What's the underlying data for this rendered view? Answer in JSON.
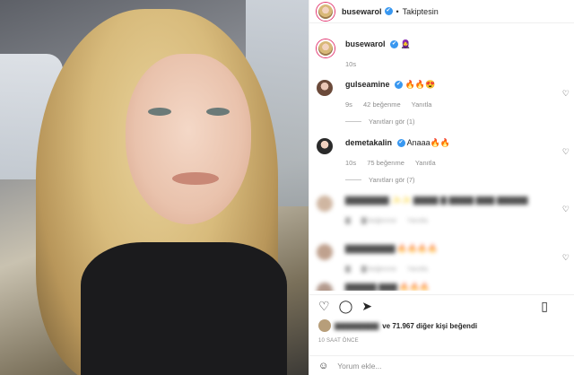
{
  "post": {
    "username": "busewarol",
    "follow_status": "Takiptesin",
    "caption_emoji": "🧕",
    "caption_time": "10s"
  },
  "comments": [
    {
      "username": "gulseamine",
      "text": "🔥🔥😍",
      "time": "9s",
      "likes": "42 beğenme",
      "reply": "Yanıtla",
      "view_replies": "Yanıtları gör (1)"
    },
    {
      "username": "demetakalin",
      "text": "Anaaa🔥🔥",
      "time": "10s",
      "likes": "75 beğenme",
      "reply": "Yanıtla",
      "view_replies": "Yanıtları gör (7)"
    },
    {
      "username": "▇▇▇▇▇▇▇",
      "text": "✨✨ ▇▇▇▇ ▇ ▇▇▇▇ ▇▇▇ ▇▇▇▇▇",
      "time": "▇",
      "likes": "▇ beğenme",
      "reply": "Yanıtla"
    },
    {
      "username": "▇▇▇▇▇▇▇▇",
      "text": "🔥🔥🔥🔥",
      "time": "▇",
      "likes": "▇ beğenme",
      "reply": "Yanıtla"
    },
    {
      "username": "▇▇▇▇▇",
      "text": "▇▇▇ 🔥🔥🔥",
      "time": "",
      "likes": "",
      "reply": ""
    }
  ],
  "likes": {
    "blurred_name": "▇▇▇▇▇▇▇▇",
    "text": "ve 71.967 diğer kişi beğendi"
  },
  "timestamp": "10 SAAT ÖNCE",
  "composer": {
    "placeholder": "Yorum ekle..."
  },
  "icons": {
    "heart": "♡",
    "comment": "◯",
    "share": "➤",
    "save": "▯",
    "emoji": "☺",
    "check": "✔"
  }
}
